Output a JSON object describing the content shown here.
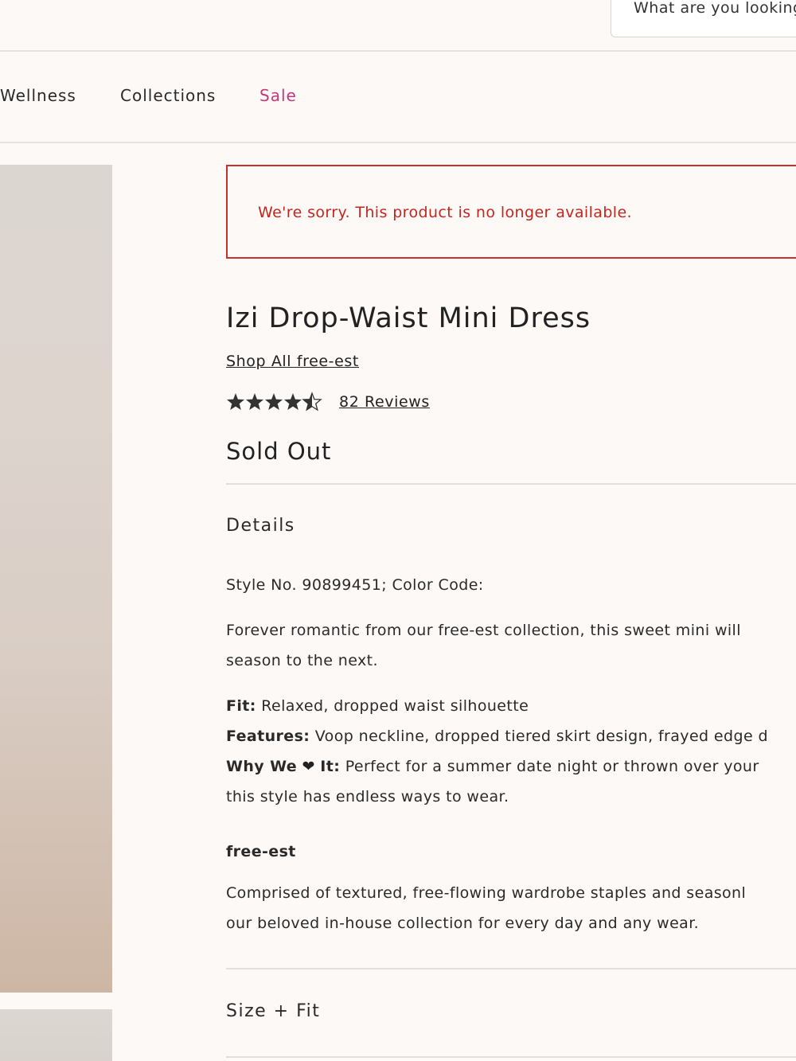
{
  "header": {
    "search_placeholder": "What are you looking for?"
  },
  "nav": {
    "items": [
      {
        "label": "Wellness"
      },
      {
        "label": "Collections"
      },
      {
        "label": "Sale"
      }
    ]
  },
  "alert": {
    "message": "We're sorry. This product is no longer available."
  },
  "product": {
    "title": "Izi Drop-Waist Mini Dress",
    "brand_link": "Shop All free-est",
    "rating": 4.5,
    "rating_max": 5,
    "reviews_link": "82 Reviews",
    "status": "Sold Out"
  },
  "details": {
    "heading": "Details",
    "style_line": "Style No. 90899451; Color Code:",
    "description_line1": "Forever romantic from our free-est collection, this sweet mini will",
    "description_line2": "season to the next.",
    "fit_label": "Fit:",
    "fit_value": "Relaxed, dropped waist silhouette",
    "features_label": "Features:",
    "features_value": "Voop neckline, dropped tiered skirt design, frayed edge d",
    "why_label_a": "Why We",
    "why_label_b": "It:",
    "why_value": "Perfect for a summer date night or thrown over your",
    "why_value_line2": "this style has endless ways to wear.",
    "brand_heading": "free-est",
    "brand_desc_line1": "Comprised of textured, free-flowing wardrobe staples and seasonl",
    "brand_desc_line2": "our beloved in-house collection for every day and any wear."
  },
  "size_fit": {
    "heading": "Size + Fit"
  }
}
